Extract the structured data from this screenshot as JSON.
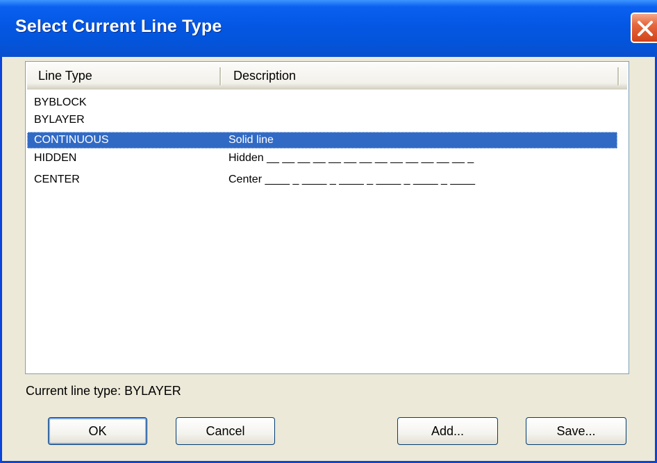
{
  "window": {
    "title": "Select Current Line Type"
  },
  "list": {
    "columns": [
      "Line Type",
      "Description"
    ],
    "rows": [
      {
        "line_type": "BYBLOCK",
        "description": ""
      },
      {
        "line_type": "BYLAYER",
        "description": ""
      },
      {
        "line_type": "CONTINUOUS",
        "description": "Solid line"
      },
      {
        "line_type": "HIDDEN",
        "description": "Hidden __ __ __ __ __ __ __ __ __ __ __ __ __ _"
      },
      {
        "line_type": "CENTER",
        "description": "Center ____ _ ____ _ ____ _ ____ _ ____ _ ____"
      }
    ],
    "selected_index": 2
  },
  "status": {
    "current_line_type": "Current line type: BYLAYER"
  },
  "buttons": {
    "ok": "OK",
    "cancel": "Cancel",
    "add": "Add...",
    "save": "Save..."
  },
  "colors": {
    "selection": "#316ac5",
    "title_bar": "#0457e3",
    "close": "#d2431a"
  }
}
